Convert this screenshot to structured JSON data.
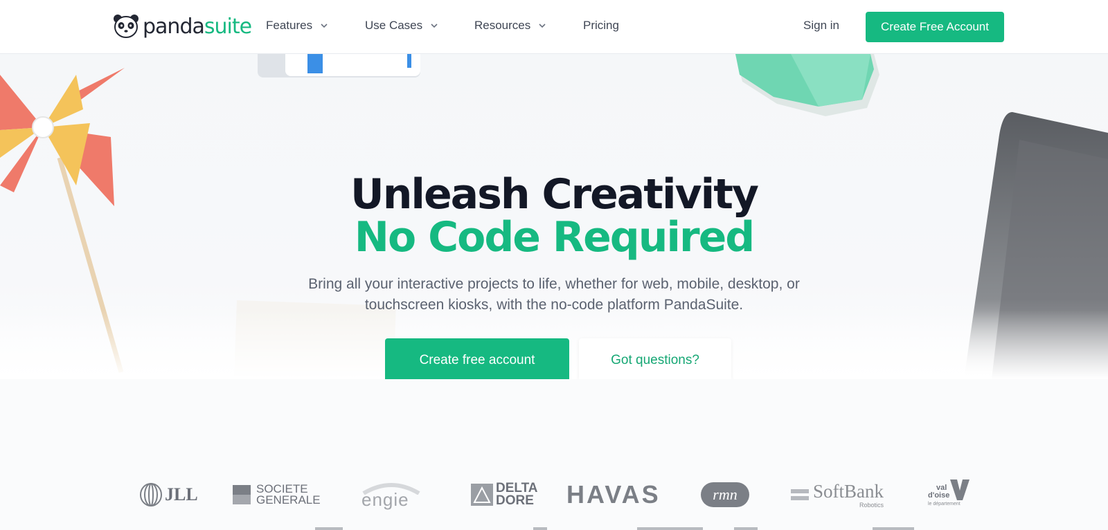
{
  "brand": {
    "name_part1": "panda",
    "name_part2": "suite"
  },
  "nav": {
    "items": [
      {
        "label": "Features",
        "has_dropdown": true
      },
      {
        "label": "Use Cases",
        "has_dropdown": true
      },
      {
        "label": "Resources",
        "has_dropdown": true
      },
      {
        "label": "Pricing",
        "has_dropdown": false
      }
    ],
    "sign_in": "Sign in",
    "cta": "Create Free Account"
  },
  "hero": {
    "title_line1": "Unleash Creativity",
    "title_line2": "No Code Required",
    "subtitle_line1": "Bring all your interactive projects to life, whether for web, mobile, desktop, or",
    "subtitle_line2": "touchscreen kiosks, with the no-code platform PandaSuite.",
    "primary_button": "Create free account",
    "secondary_button": "Got questions?"
  },
  "client_logos": {
    "jll": "JLL",
    "societe_generale_1": "SOCIETE",
    "societe_generale_2": "GENERALE",
    "engie": "engie",
    "delta_dore_1": "DELTA",
    "delta_dore_2": "DORE",
    "havas": "HAVAS",
    "rmn": "rmn",
    "softbank": "SoftBank",
    "softbank_sub": "Robotics",
    "valdoise_1": "val",
    "valdoise_2": "d'oise",
    "valdoise_sub": "le département"
  },
  "colors": {
    "accent": "#16b981",
    "heading": "#131826",
    "text": "#5b6270"
  }
}
